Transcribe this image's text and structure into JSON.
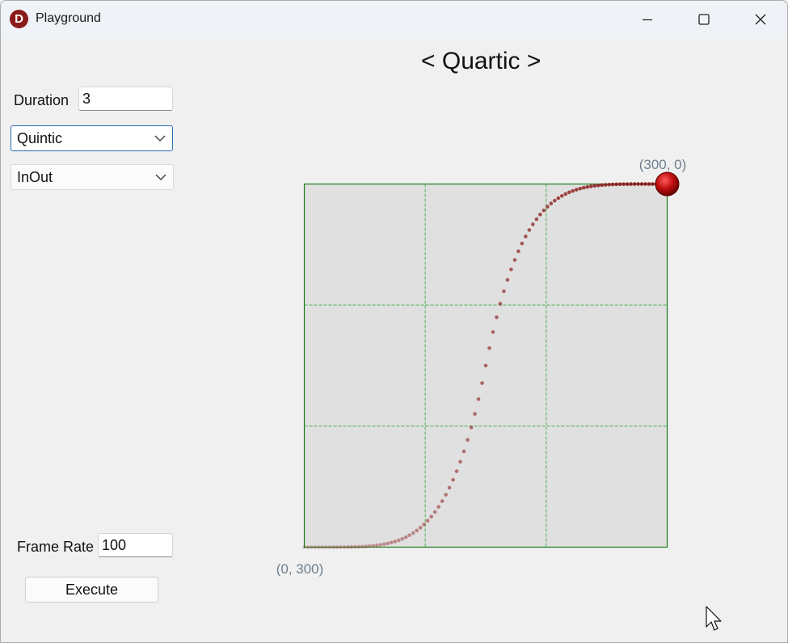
{
  "window": {
    "title": "Playground"
  },
  "controls": {
    "duration_label": "Duration",
    "duration_value": "3",
    "easing_selected": "Quintic",
    "mode_selected": "InOut",
    "frame_rate_label": "Frame Rate",
    "frame_rate_value": "100",
    "execute_label": "Execute"
  },
  "preview": {
    "title": "< Quartic >",
    "end_label": "(300, 0)",
    "start_label": "(0, 300)"
  },
  "icons": {
    "app": "app-logo-icon",
    "minimize": "minimize-icon",
    "maximize": "maximize-icon",
    "close": "close-icon",
    "dropdown": "chevron-down-icon",
    "cursor": "mouse-pointer-icon"
  },
  "colors": {
    "plot_background": "#e0e0e0",
    "plot_border": "#1a7a1a",
    "grid": "#4caf50",
    "dots": "#8b1a1a",
    "ball": "#c01010",
    "corner_label": "#6e7f8e"
  },
  "chart_data": {
    "type": "scatter",
    "x_range": [
      0,
      300
    ],
    "y_range": [
      0,
      300
    ],
    "grid": true,
    "samples": 100
  }
}
